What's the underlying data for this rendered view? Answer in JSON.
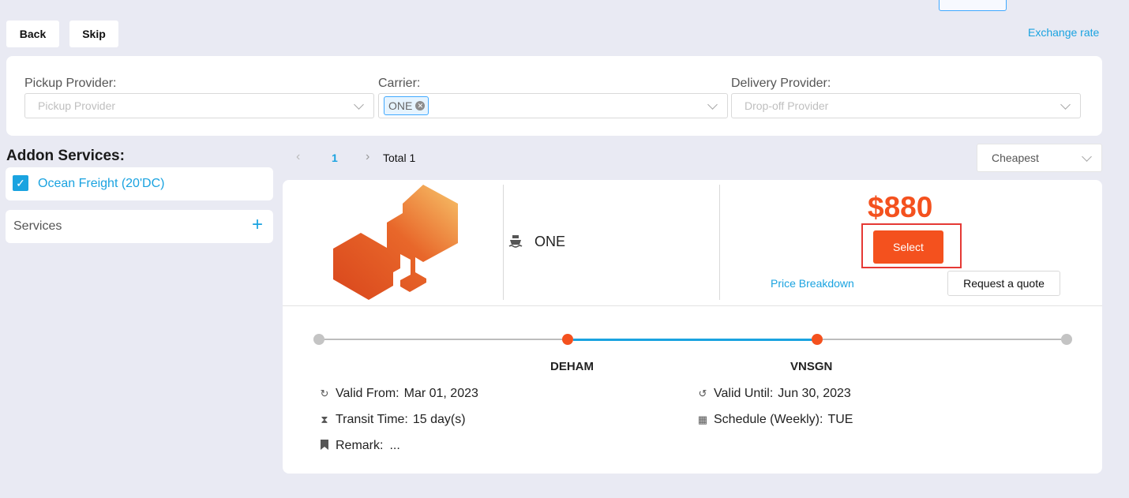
{
  "top_buttons": {
    "back": "Back",
    "skip": "Skip"
  },
  "exchange_rate": "Exchange rate",
  "filters": {
    "pickup": {
      "label": "Pickup Provider:",
      "placeholder": "Pickup Provider"
    },
    "carrier": {
      "label": "Carrier:",
      "selected_tag": "ONE"
    },
    "delivery": {
      "label": "Delivery Provider:",
      "placeholder": "Drop-off Provider"
    }
  },
  "addon": {
    "title": "Addon Services:",
    "item": {
      "label": "Ocean Freight (20'DC)",
      "checked": true
    },
    "services_label": "Services"
  },
  "pagination": {
    "current": "1",
    "total": "Total 1"
  },
  "sort": {
    "value": "Cheapest"
  },
  "result": {
    "carrier": "ONE",
    "price": "$880",
    "select_label": "Select",
    "price_breakdown": "Price Breakdown",
    "request_quote": "Request a quote",
    "route": {
      "origin": "DEHAM",
      "destination": "VNSGN"
    },
    "details": {
      "valid_from_label": "Valid From:",
      "valid_from": "Mar 01, 2023",
      "valid_until_label": "Valid Until:",
      "valid_until": "Jun 30, 2023",
      "transit_label": "Transit Time:",
      "transit": "15 day(s)",
      "schedule_label": "Schedule (Weekly):",
      "schedule": "TUE",
      "remark_label": "Remark:",
      "remark": "..."
    }
  },
  "colors": {
    "accent": "#1aa3e0",
    "orange": "#f4511e",
    "highlight_border": "#e53935"
  }
}
